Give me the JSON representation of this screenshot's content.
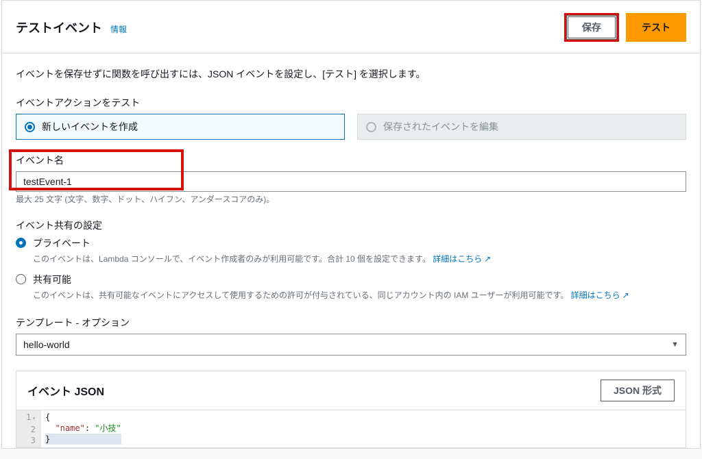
{
  "header": {
    "title": "テストイベント",
    "info_link": "情報",
    "save_label": "保存",
    "test_label": "テスト"
  },
  "intro": "イベントを保存せずに関数を呼び出すには、JSON イベントを設定し、[テスト] を選択します。",
  "event_action": {
    "label": "イベントアクションをテスト",
    "create_new": "新しいイベントを作成",
    "edit_saved": "保存されたイベントを編集"
  },
  "event_name": {
    "label": "イベント名",
    "value": "testEvent-1",
    "hint": "最大 25 文字 (文字、数字、ドット、ハイフン、アンダースコアのみ)。"
  },
  "sharing": {
    "label": "イベント共有の設定",
    "private": {
      "label": "プライベート",
      "desc": "このイベントは、Lambda コンソールで、イベント作成者のみが利用可能です。合計 10 個を設定できます。",
      "more": "詳細はこちら"
    },
    "shared": {
      "label": "共有可能",
      "desc": "このイベントは、共有可能なイベントにアクセスして使用するための許可が付与されている、同じアカウント内の IAM ユーザーが利用可能です。",
      "more": "詳細はこちら"
    }
  },
  "template": {
    "label": "テンプレート - オプション",
    "selected": "hello-world"
  },
  "json": {
    "title": "イベント JSON",
    "format_button": "JSON 形式",
    "lines": [
      "{",
      "  \"name\": \"小技\"",
      "}"
    ]
  }
}
